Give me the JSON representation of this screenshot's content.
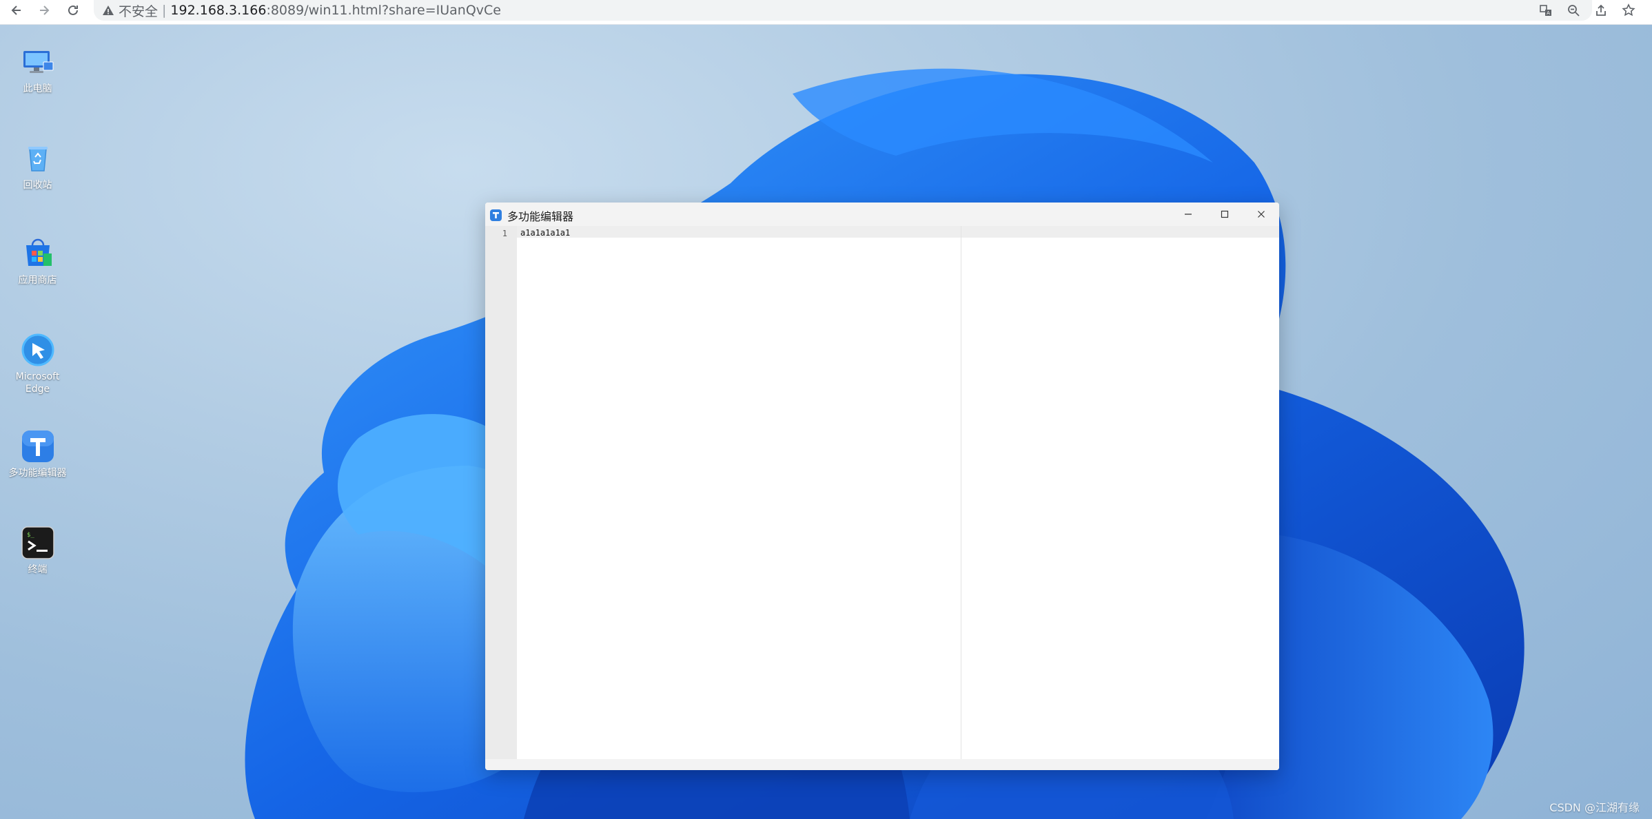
{
  "browser": {
    "security_label": "不安全",
    "separator": "|",
    "url_host": "192.168.3.166",
    "url_path": ":8089/win11.html?share=IUanQvCe"
  },
  "desktop": {
    "icons": [
      {
        "label": "此电脑",
        "icon": "computer-icon"
      },
      {
        "label": "回收站",
        "icon": "recycle-bin-icon"
      },
      {
        "label": "应用商店",
        "icon": "store-icon"
      },
      {
        "label": "Microsoft\nEdge",
        "icon": "edge-icon"
      },
      {
        "label": "多功能编辑器",
        "icon": "editor-icon"
      },
      {
        "label": "终端",
        "icon": "terminal-icon"
      }
    ]
  },
  "window": {
    "title": "多功能编辑器",
    "app_icon_letter": "T",
    "line_number": "1",
    "content": "a1a1a1a1a1"
  },
  "watermark": "CSDN @江湖有缘"
}
